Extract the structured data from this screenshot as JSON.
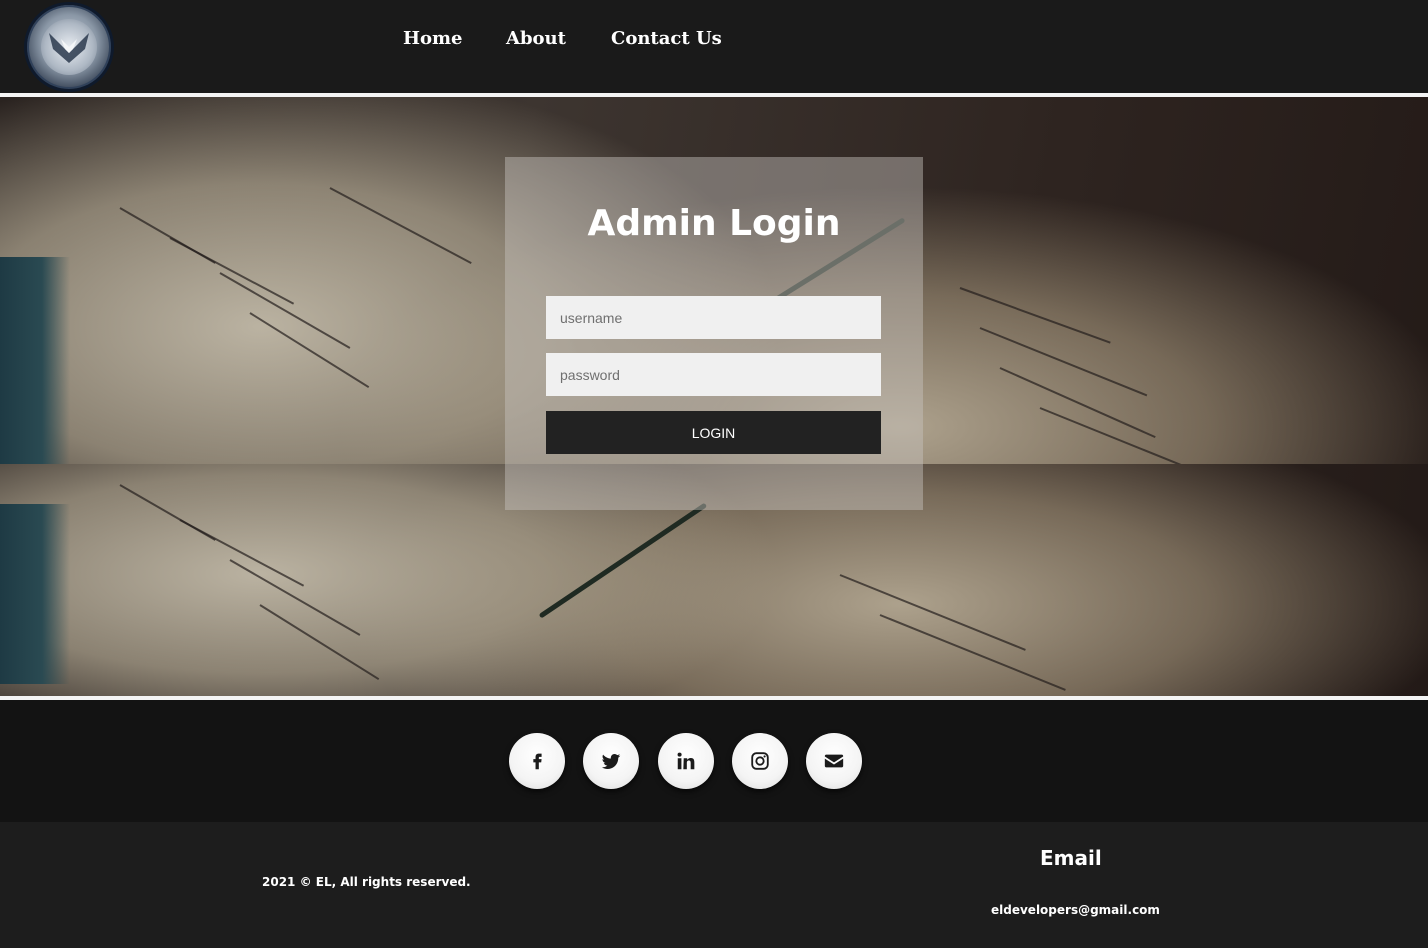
{
  "nav": {
    "home": "Home",
    "about": "About",
    "contact": "Contact Us"
  },
  "login": {
    "title": "Admin Login",
    "username_placeholder": "username",
    "password_placeholder": "password",
    "button": "LOGIN"
  },
  "social": [
    "facebook-icon",
    "twitter-icon",
    "linkedin-icon",
    "instagram-icon",
    "mail-icon"
  ],
  "footer": {
    "copyright": "2021 © EL, All rights reserved.",
    "email_heading": "Email",
    "email_address": "eldevelopers@gmail.com"
  },
  "colors": {
    "header_bg": "#1a1a1a",
    "button_bg": "#222222",
    "footer_bg": "#1d1d1d"
  }
}
